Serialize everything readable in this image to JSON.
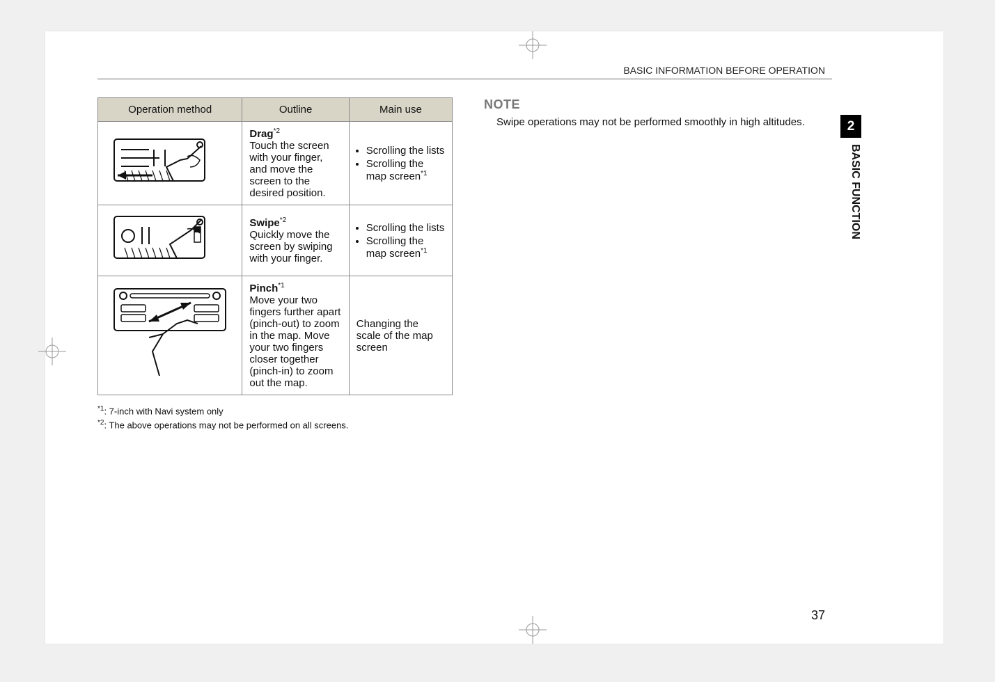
{
  "header": {
    "running_head": "BASIC INFORMATION BEFORE OPERATION"
  },
  "side": {
    "chapter_num": "2",
    "chapter_label": "BASIC FUNCTION"
  },
  "page_number": "37",
  "table": {
    "headers": {
      "col1": "Operation method",
      "col2": "Outline",
      "col3": "Main use"
    },
    "rows": [
      {
        "outline_label": "Drag",
        "outline_sup": "*2",
        "outline_body": "Touch the screen with your finger, and move the screen to the desired position.",
        "use1": "Scrolling the lists",
        "use2_a": "Scrolling the map screen",
        "use2_sup": "*1"
      },
      {
        "outline_label": "Swipe",
        "outline_sup": "*2",
        "outline_body": "Quickly move the screen by swiping with your finger.",
        "use1": "Scrolling the lists",
        "use2_a": "Scrolling the map screen",
        "use2_sup": "*1"
      },
      {
        "outline_label": "Pinch",
        "outline_sup": "*1",
        "outline_body": "Move your two fingers further apart (pinch-out) to zoom in the map. Move your two fingers closer together (pinch-in) to zoom out the map.",
        "use_single": "Changing the scale of the map screen"
      }
    ]
  },
  "footnotes": {
    "f1_sup": "*1",
    "f1_text": ": 7-inch with Navi system only",
    "f2_sup": "*2",
    "f2_text": ": The above operations may not be performed on all screens."
  },
  "note": {
    "title": "NOTE",
    "body": "Swipe operations may not be performed smoothly in high altitudes."
  }
}
